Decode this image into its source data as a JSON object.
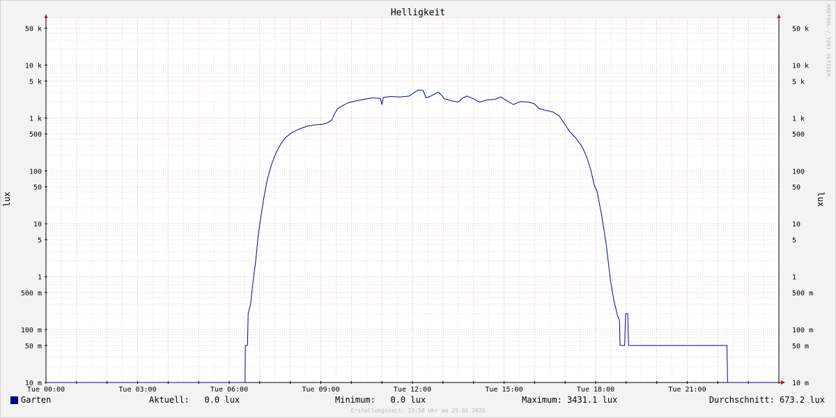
{
  "chart_data": {
    "type": "line",
    "title": "Helligkeit",
    "ylabel": "lux",
    "y_scale": "log",
    "ylim": [
      0.01,
      75000
    ],
    "xlim_hours": [
      0,
      24
    ],
    "y_ticks": [
      {
        "value": 50000,
        "label": "50 k"
      },
      {
        "value": 10000,
        "label": "10 k"
      },
      {
        "value": 5000,
        "label": "5 k"
      },
      {
        "value": 1000,
        "label": "1 k"
      },
      {
        "value": 500,
        "label": "500"
      },
      {
        "value": 100,
        "label": "100"
      },
      {
        "value": 50,
        "label": "50"
      },
      {
        "value": 10,
        "label": "10"
      },
      {
        "value": 5,
        "label": "5"
      },
      {
        "value": 1,
        "label": "1"
      },
      {
        "value": 0.5,
        "label": "500 m"
      },
      {
        "value": 0.1,
        "label": "100 m"
      },
      {
        "value": 0.05,
        "label": "50 m"
      },
      {
        "value": 0.01,
        "label": "10 m"
      }
    ],
    "x_ticks": [
      {
        "hour": 0,
        "label": "Tue 00:00"
      },
      {
        "hour": 3,
        "label": "Tue 03:00"
      },
      {
        "hour": 6,
        "label": "Tue 06:00"
      },
      {
        "hour": 9,
        "label": "Tue 09:00"
      },
      {
        "hour": 12,
        "label": "Tue 12:00"
      },
      {
        "hour": 15,
        "label": "Tue 15:00"
      },
      {
        "hour": 18,
        "label": "Tue 18:00"
      },
      {
        "hour": 21,
        "label": "Tue 21:00"
      }
    ],
    "colors": {
      "series": "#0000a0",
      "major_grid": "#e8a0a0",
      "minor_grid": "#c8c8c8",
      "axis": "#000000",
      "arrow": "#a02020",
      "background": "#ffffff"
    },
    "series": [
      {
        "name": "Garten",
        "points": [
          [
            0.0,
            0.01
          ],
          [
            6.52,
            0.01
          ],
          [
            6.53,
            0.05
          ],
          [
            6.6,
            0.05
          ],
          [
            6.62,
            0.2
          ],
          [
            6.7,
            0.3
          ],
          [
            6.78,
            0.8
          ],
          [
            6.87,
            2
          ],
          [
            6.95,
            6
          ],
          [
            7.05,
            15
          ],
          [
            7.15,
            35
          ],
          [
            7.25,
            70
          ],
          [
            7.4,
            140
          ],
          [
            7.55,
            230
          ],
          [
            7.7,
            330
          ],
          [
            7.85,
            430
          ],
          [
            8.05,
            530
          ],
          [
            8.3,
            620
          ],
          [
            8.55,
            700
          ],
          [
            8.8,
            740
          ],
          [
            9.05,
            760
          ],
          [
            9.2,
            800
          ],
          [
            9.35,
            900
          ],
          [
            9.45,
            1200
          ],
          [
            9.55,
            1500
          ],
          [
            9.7,
            1700
          ],
          [
            9.9,
            1950
          ],
          [
            10.15,
            2100
          ],
          [
            10.4,
            2250
          ],
          [
            10.7,
            2400
          ],
          [
            10.95,
            2350
          ],
          [
            11.0,
            1800
          ],
          [
            11.05,
            2450
          ],
          [
            11.3,
            2550
          ],
          [
            11.6,
            2500
          ],
          [
            11.9,
            2600
          ],
          [
            12.05,
            3000
          ],
          [
            12.2,
            3400
          ],
          [
            12.35,
            3300
          ],
          [
            12.45,
            2400
          ],
          [
            12.6,
            2600
          ],
          [
            12.75,
            2900
          ],
          [
            12.85,
            3100
          ],
          [
            12.95,
            2700
          ],
          [
            13.05,
            2300
          ],
          [
            13.3,
            2100
          ],
          [
            13.5,
            2000
          ],
          [
            13.65,
            2400
          ],
          [
            13.8,
            2600
          ],
          [
            14.0,
            2300
          ],
          [
            14.2,
            2000
          ],
          [
            14.45,
            2200
          ],
          [
            14.7,
            2250
          ],
          [
            14.9,
            2500
          ],
          [
            15.05,
            2200
          ],
          [
            15.3,
            1800
          ],
          [
            15.55,
            2050
          ],
          [
            15.8,
            2000
          ],
          [
            16.0,
            1850
          ],
          [
            16.15,
            1500
          ],
          [
            16.35,
            1400
          ],
          [
            16.6,
            1300
          ],
          [
            16.8,
            1100
          ],
          [
            17.0,
            750
          ],
          [
            17.15,
            550
          ],
          [
            17.35,
            420
          ],
          [
            17.55,
            290
          ],
          [
            17.7,
            190
          ],
          [
            17.85,
            100
          ],
          [
            17.95,
            55
          ],
          [
            18.05,
            40
          ],
          [
            18.2,
            14
          ],
          [
            18.35,
            4
          ],
          [
            18.48,
            0.9
          ],
          [
            18.6,
            0.35
          ],
          [
            18.72,
            0.18
          ],
          [
            18.78,
            0.15
          ],
          [
            18.8,
            0.05
          ],
          [
            18.95,
            0.05
          ],
          [
            18.98,
            0.2
          ],
          [
            19.05,
            0.2
          ],
          [
            19.08,
            0.05
          ],
          [
            22.3,
            0.05
          ],
          [
            22.32,
            0.01
          ],
          [
            24.0,
            0.01
          ]
        ]
      }
    ]
  },
  "page": {
    "title": "Helligkeit",
    "ylabel": "lux",
    "watermark": "RRDTOOL / TOBI OETIKER",
    "footer": "Erstellungszeit: 23:58 Uhr am 25.02.2025"
  },
  "legend": {
    "series_name": "Garten",
    "current": "Aktuell:   0.0 lux",
    "minimum": "Minimum:   0.0 lux",
    "maximum": "Maximum: 3431.1 lux",
    "average": "Durchschnitt: 673.2 lux"
  }
}
